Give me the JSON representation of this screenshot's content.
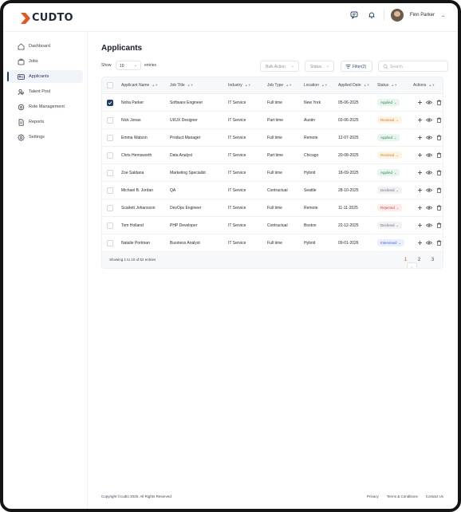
{
  "brand": {
    "name": "CUDTO"
  },
  "header": {
    "user_name": "Finn Parker"
  },
  "sidebar": {
    "items": [
      {
        "label": "Dashboard",
        "icon": "dashboard-icon"
      },
      {
        "label": "Jobs",
        "icon": "briefcase-icon"
      },
      {
        "label": "Applicants",
        "icon": "id-card-icon",
        "active": true
      },
      {
        "label": "Talent Pool",
        "icon": "users-icon"
      },
      {
        "label": "Role Management",
        "icon": "gear-icon"
      },
      {
        "label": "Reports",
        "icon": "document-icon"
      },
      {
        "label": "Settings",
        "icon": "settings-icon"
      }
    ]
  },
  "main": {
    "title": "Applicants",
    "controls": {
      "show_label": "Show",
      "show_value": "10",
      "entries_label": "entries",
      "bulk_action": "Bulk Action",
      "status_filter": "Status",
      "filter_label": "Filter(2)",
      "search_placeholder": "Search"
    },
    "columns": [
      "Applicant Name",
      "Job Title",
      "Industry",
      "Job Type",
      "Location",
      "Applied Date",
      "Status",
      "Actions"
    ],
    "rows": [
      {
        "name": "Noha Parker",
        "job": "Software Engineer",
        "industry": "IT Service",
        "type": "Full time",
        "location": "New York",
        "date": "05-06-2025",
        "status": "Applied",
        "checked": true
      },
      {
        "name": "Nick Jonas",
        "job": "UI/UX Designer",
        "industry": "IT Service",
        "type": "Part time",
        "location": "Austin",
        "date": "03-06-2025",
        "status": "Reviewd",
        "checked": false
      },
      {
        "name": "Emma Watson",
        "job": "Product Manager",
        "industry": "IT Service",
        "type": "Full time",
        "location": "Remote",
        "date": "12-07-2025",
        "status": "Applied",
        "checked": false
      },
      {
        "name": "Chris Hemsworth",
        "job": "Data Analyst",
        "industry": "IT Service",
        "type": "Part time",
        "location": "Chicago",
        "date": "20-08-2025",
        "status": "Reviewd",
        "checked": false
      },
      {
        "name": "Zoe Saldana",
        "job": "Marketing Specialist",
        "industry": "IT Service",
        "type": "Full time",
        "location": "Hybrid",
        "date": "18-09-2025",
        "status": "Applied",
        "checked": false
      },
      {
        "name": "Michael B. Jordan",
        "job": "QA",
        "industry": "IT Service",
        "type": "Contractual",
        "location": "Seattle",
        "date": "28-10-2025",
        "status": "Declined",
        "checked": false
      },
      {
        "name": "Scarlett Johansson",
        "job": "DevOps Engineer",
        "industry": "IT Service",
        "type": "Full time",
        "location": "Remote",
        "date": "11-11-2025",
        "status": "Rejected",
        "checked": false
      },
      {
        "name": "Tom Holland",
        "job": "PHP Developer",
        "industry": "IT Service",
        "type": "Contractual",
        "location": "Boston",
        "date": "22-12-2025",
        "status": "Declined",
        "checked": false
      },
      {
        "name": "Natalie Portman",
        "job": "Business Analyst",
        "industry": "IT Service",
        "type": "Full time",
        "location": "Hybrid",
        "date": "09-01-2026",
        "status": "Interviewd",
        "checked": false
      }
    ],
    "status_colors": {
      "Applied": {
        "bg": "#e6f6ec",
        "fg": "#2e8b57"
      },
      "Reviewd": {
        "bg": "#fff3e3",
        "fg": "#d9820f"
      },
      "Declined": {
        "bg": "#f1f2f4",
        "fg": "#6b7280"
      },
      "Rejected": {
        "bg": "#fdeceb",
        "fg": "#d9413b"
      },
      "Interviewd": {
        "bg": "#e9effc",
        "fg": "#3b66d6"
      }
    },
    "pagination": {
      "info": "Showing 1 to 10 of 62 entries",
      "pages": [
        "1",
        "2",
        "3"
      ],
      "active_page": "1"
    }
  },
  "footer": {
    "copyright": "Copyright ©cudto 2025. All Rights Reserved",
    "links": [
      "Privacy",
      "Terms & Conditions",
      "Contact Us"
    ]
  },
  "colors": {
    "brand_orange": "#e8561f",
    "brand_navy": "#1d3b6b"
  }
}
